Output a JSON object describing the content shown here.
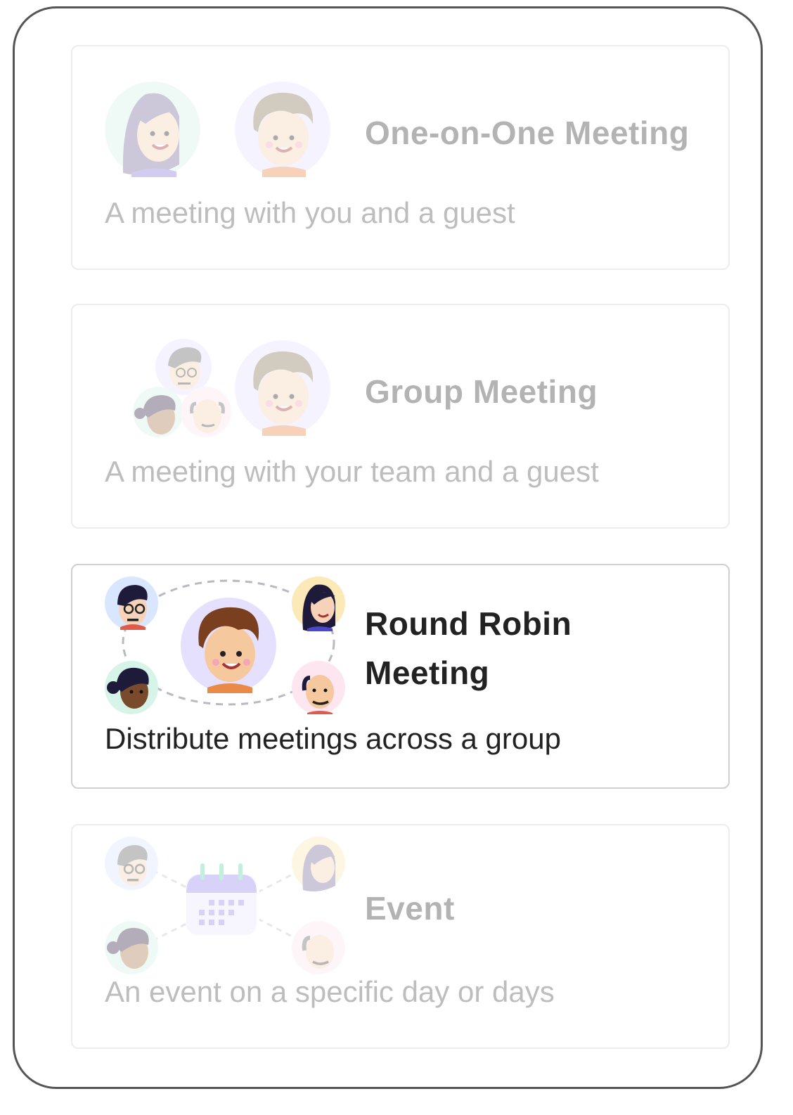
{
  "options": [
    {
      "title": "One-on-One Meeting",
      "description": "A meeting with you and a guest",
      "selected": false,
      "illustration": "host-and-guest-avatars"
    },
    {
      "title": "Group Meeting",
      "description": "A meeting with your team and a guest",
      "selected": false,
      "illustration": "team-and-guest-avatars"
    },
    {
      "title": "Round Robin Meeting",
      "description": "Distribute meetings across a group",
      "selected": true,
      "illustration": "round-robin-avatars"
    },
    {
      "title": "Event",
      "description": "An event on a specific day or days",
      "selected": false,
      "illustration": "event-calendar-avatars"
    }
  ],
  "colors": {
    "title": "#222222",
    "border": "#ededf0",
    "selected_border": "#cfcfd4",
    "avatar_purple": "#e6e0ff",
    "avatar_green": "#d6f4e8",
    "avatar_yellow": "#fbe9b8",
    "avatar_pink": "#fde6ef",
    "avatar_blue": "#d8e6ff"
  }
}
